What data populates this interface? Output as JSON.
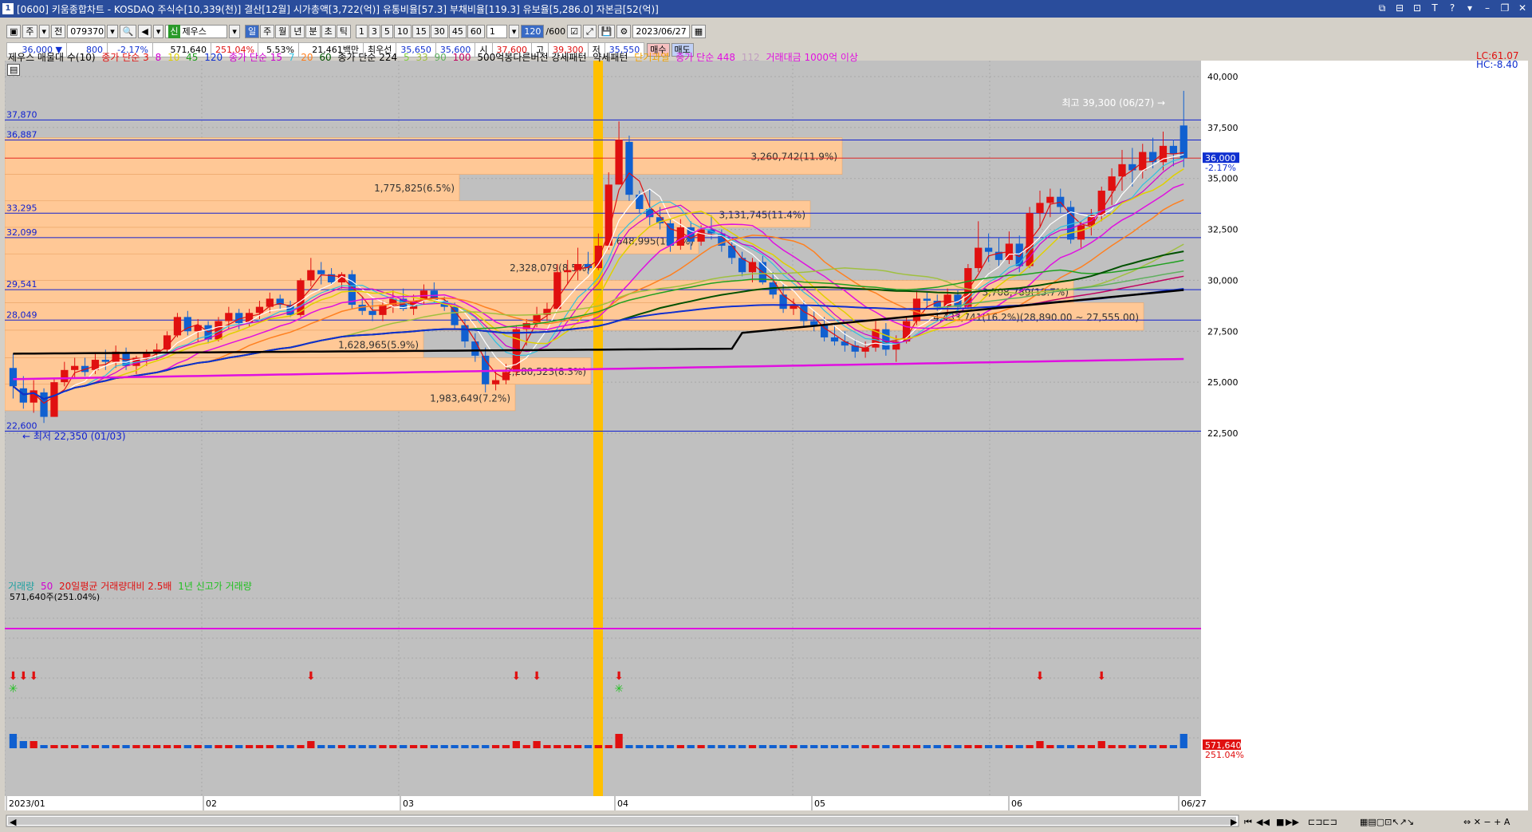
{
  "window": {
    "icon_label": "1",
    "title": "[0600] 키움종합차트 - KOSDAQ 주식수[10,339(천)] 결산[12월] 시가총액[3,722(억)] 유통비율[57.3] 부채비율[119.3] 유보율[5,286.0] 자본금[52(억)]",
    "right_controls": [
      "⧉",
      "⊟",
      "⊡",
      "T",
      "?",
      "▾",
      "–",
      "❐",
      "✕"
    ]
  },
  "toolbar": {
    "period_select": "주",
    "mode": "전",
    "code": "079370",
    "stock_name": "제우스",
    "tabs": [
      "일",
      "주",
      "월",
      "년",
      "분",
      "초",
      "틱"
    ],
    "active_tab": "일",
    "minute_buttons": [
      "1",
      "3",
      "5",
      "10",
      "15",
      "30",
      "45",
      "60"
    ],
    "unit": "1",
    "count_a": "120",
    "count_b": "/600",
    "date": "2023/06/27",
    "buy_label": "매수",
    "sell_label": "매도"
  },
  "quote": {
    "price": "36,000",
    "change": "800",
    "change_pct": "-2.17%",
    "volume": "571,640",
    "vol_ratio": "251.04%",
    "turnover": "5.53%",
    "amount": "21,461백만",
    "best_bid_label": "최우선",
    "best_ask": "35,650",
    "best_bid": "35,600",
    "open_label": "시",
    "open": "37,600",
    "high_label": "고",
    "high": "39,300",
    "low_label": "저",
    "low": "35,550"
  },
  "price_legend": [
    {
      "text": "제우스 매물대 수(10)",
      "color": "#000000"
    },
    {
      "text": "종가 단순 3",
      "color": "#e01010"
    },
    {
      "text": "8",
      "color": "#d000d0"
    },
    {
      "text": "10",
      "color": "#e0d000"
    },
    {
      "text": "45",
      "color": "#20a020"
    },
    {
      "text": "120",
      "color": "#1030d0"
    },
    {
      "text": "종가 단순 15",
      "color": "#d000d0"
    },
    {
      "text": "7",
      "color": "#30c0e0"
    },
    {
      "text": "20",
      "color": "#ff8020"
    },
    {
      "text": "60",
      "color": "#005000"
    },
    {
      "text": "종가 단순 224",
      "color": "#000000"
    },
    {
      "text": "5",
      "color": "#80d040"
    },
    {
      "text": "33",
      "color": "#a0c040"
    },
    {
      "text": "90",
      "color": "#60b060"
    },
    {
      "text": "100",
      "color": "#c00060"
    },
    {
      "text": "500억봉다른버전 강세패턴",
      "color": "#000000"
    },
    {
      "text": "약세패턴",
      "color": "#000000"
    },
    {
      "text": "단기과열",
      "color": "#f0a000"
    },
    {
      "text": "종가 단순 448",
      "color": "#e010e0"
    },
    {
      "text": "112",
      "color": "#c0a0c0"
    },
    {
      "text": "거래대금 1000억 이상",
      "color": "#e010e0"
    }
  ],
  "lc_label": "LC:61.07",
  "hc_label": "HC:-8.40",
  "max_label": "최고 39,300 (06/27)",
  "min_label": "최저 22,350 (01/03)",
  "current_price_tag": "36,000",
  "current_pct_tag": "-2.17%",
  "y_ticks": [
    "40,000",
    "37,500",
    "35,000",
    "32,500",
    "30,000",
    "27,500",
    "25,000",
    "22,500"
  ],
  "hlines": [
    "37,870",
    "36,887",
    "33,295",
    "32,099",
    "29,541",
    "28,049",
    "22,600"
  ],
  "volume_profile": [
    {
      "label": "3,260,742(11.9%)"
    },
    {
      "label": "1,775,825(6.5%)"
    },
    {
      "label": "3,131,745(11.4%)"
    },
    {
      "label": "2,648,995(10.4%)"
    },
    {
      "label": "2,328,079(8.5%)"
    },
    {
      "label": "3,708,789(13.7%)"
    },
    {
      "label": "4,433,741(16.2%)(28,890.00 ~ 27,555.00)"
    },
    {
      "label": "1,628,965(5.9%)"
    },
    {
      "label": "2,280,523(8.3%)"
    },
    {
      "label": "1,983,649(7.2%)"
    }
  ],
  "volume_legend": [
    {
      "text": "거래량",
      "color": "#20a0a0"
    },
    {
      "text": "50",
      "color": "#d000d0"
    },
    {
      "text": "20일평균 거래량대비 2.5배",
      "color": "#e01010"
    },
    {
      "text": "1년 신고가 거래량",
      "color": "#20c020"
    }
  ],
  "volume_value": "571,640주(251.04%)",
  "volume_tag": "571,640",
  "volume_tag_pct": "251.04%",
  "x_labels": [
    "2023/01",
    "02",
    "03",
    "04",
    "05",
    "06",
    "06/27"
  ],
  "colors": {
    "up": "#e01010",
    "down": "#1060d0",
    "hot_band": "#ffc000",
    "vp_fill": "#ffc896",
    "chart_bg": "#c0c0c0"
  }
}
